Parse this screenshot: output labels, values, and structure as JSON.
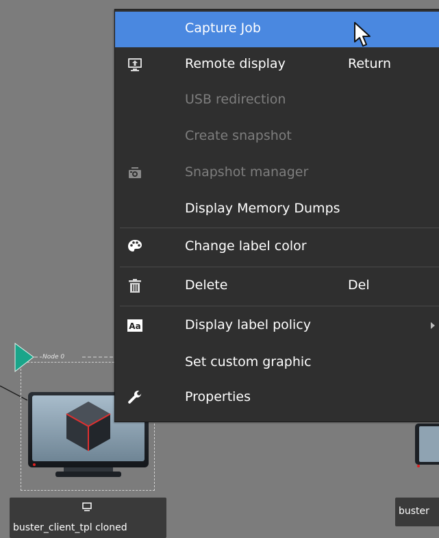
{
  "canvas": {
    "node_tag": "Node 0",
    "node_label": "buster_client_tpl cloned",
    "node2_label": "buster"
  },
  "menu": {
    "items": [
      {
        "label": "Capture Job",
        "shortcut": "",
        "icon": "",
        "enabled": true,
        "highlighted": true
      },
      {
        "label": "Remote display",
        "shortcut": "Return",
        "icon": "remote-display-icon",
        "enabled": true
      },
      {
        "label": "USB redirection",
        "shortcut": "",
        "icon": "",
        "enabled": false
      },
      {
        "label": "Create snapshot",
        "shortcut": "",
        "icon": "",
        "enabled": false
      },
      {
        "label": "Snapshot manager",
        "shortcut": "",
        "icon": "camera-icon",
        "enabled": false
      },
      {
        "label": "Display Memory Dumps",
        "shortcut": "",
        "icon": "",
        "enabled": true
      },
      {
        "label": "Change label color",
        "shortcut": "",
        "icon": "palette-icon",
        "enabled": true
      },
      {
        "label": "Delete",
        "shortcut": "Del",
        "icon": "trash-icon",
        "enabled": true
      },
      {
        "label": "Display label policy",
        "shortcut": "",
        "icon": "font-icon",
        "enabled": true,
        "submenu": true
      },
      {
        "label": "Set custom graphic",
        "shortcut": "",
        "icon": "",
        "enabled": true
      },
      {
        "label": "Properties",
        "shortcut": "",
        "icon": "wrench-icon",
        "enabled": true
      }
    ],
    "font_icon_text": "Aa"
  },
  "colors": {
    "highlight": "#4a88e0",
    "menu_bg": "#2f2f2f",
    "canvas_bg": "#7c7c7c",
    "node_start": "#1aa58a"
  }
}
